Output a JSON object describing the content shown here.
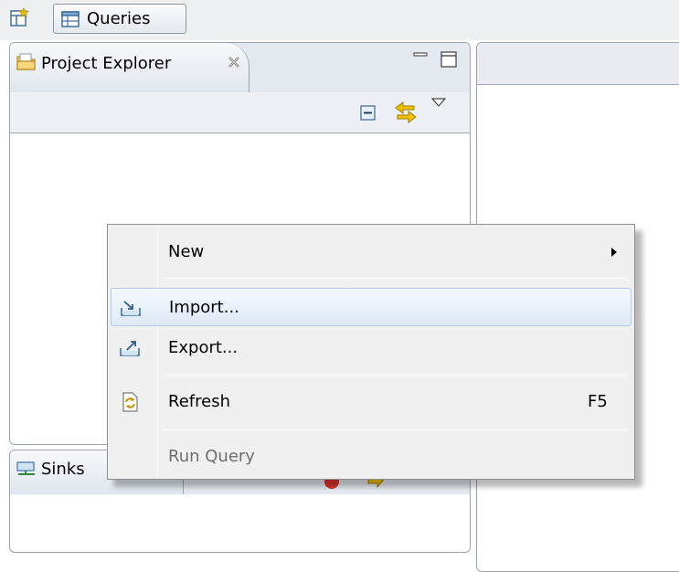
{
  "toolbar": {
    "perspective_icon": "new-perspective-icon",
    "queries_label": "Queries",
    "queries_icon": "table-icon"
  },
  "project_explorer": {
    "title": "Project Explorer",
    "tab_icon": "folder-icon",
    "close_icon": "close-icon",
    "actions": [
      "minimize-icon",
      "maximize-icon",
      "collapse-all-icon",
      "link-with-editor-icon",
      "view-menu-icon"
    ]
  },
  "sinks_view": {
    "title": "Sinks",
    "tab_icon": "monitor-icon"
  },
  "context_menu": {
    "items": [
      {
        "label": "New",
        "has_submenu": true
      },
      {
        "label": "Import...",
        "icon": "import-icon",
        "highlighted": true
      },
      {
        "label": "Export...",
        "icon": "export-icon"
      },
      {
        "label": "Refresh",
        "icon": "refresh-icon",
        "shortcut": "F5"
      },
      {
        "label": "Run Query",
        "disabled": true
      }
    ]
  },
  "colors": {
    "highlight_border": "#aeccef",
    "highlight_fill": "#dfeaf7",
    "menu_background": "#f0f0f0",
    "view_border": "#9aa6b4",
    "disabled_text": "#6d6d6d"
  }
}
